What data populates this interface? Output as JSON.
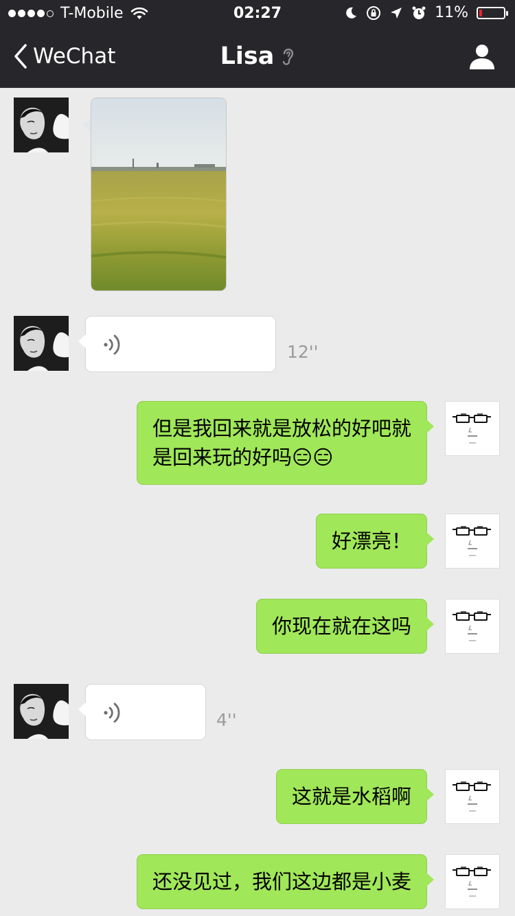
{
  "status_bar": {
    "carrier": "T-Mobile",
    "time": "02:27",
    "battery_percent_label": "11%",
    "battery_level": 0.11
  },
  "nav": {
    "back_label": "WeChat",
    "title": "Lisa"
  },
  "messages": [
    {
      "from": "Lisa",
      "type": "photo"
    },
    {
      "from": "Lisa",
      "type": "voice",
      "duration": "12''"
    },
    {
      "from": "me",
      "type": "text",
      "line1": "但是我回来就是放松的好吧就",
      "line2": "是回来玩的好吗😑😑"
    },
    {
      "from": "me",
      "type": "text",
      "text": "好漂亮！"
    },
    {
      "from": "me",
      "type": "text",
      "text": "你现在就在这吗"
    },
    {
      "from": "Lisa",
      "type": "voice",
      "duration": "4''"
    },
    {
      "from": "me",
      "type": "text",
      "text": "这就是水稻啊"
    },
    {
      "from": "me",
      "type": "text",
      "text": "还没见过，我们这边都是小麦"
    }
  ],
  "colors": {
    "nav_bg": "#27272b",
    "chat_bg": "#ebebeb",
    "outgoing_bubble": "#a0e759",
    "incoming_bubble": "#ffffff"
  }
}
